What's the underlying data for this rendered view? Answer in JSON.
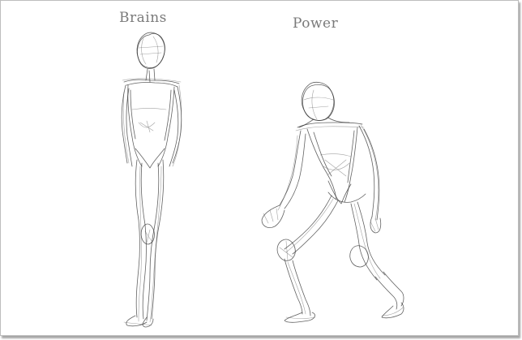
{
  "sketch": {
    "left_figure": {
      "label": "Brains"
    },
    "right_figure": {
      "label": "Power"
    }
  },
  "colors": {
    "background": "#ffffff",
    "stroke": "#2e2e2e",
    "label": "#7a7a7a",
    "frame_border": "#bdbdbd"
  }
}
